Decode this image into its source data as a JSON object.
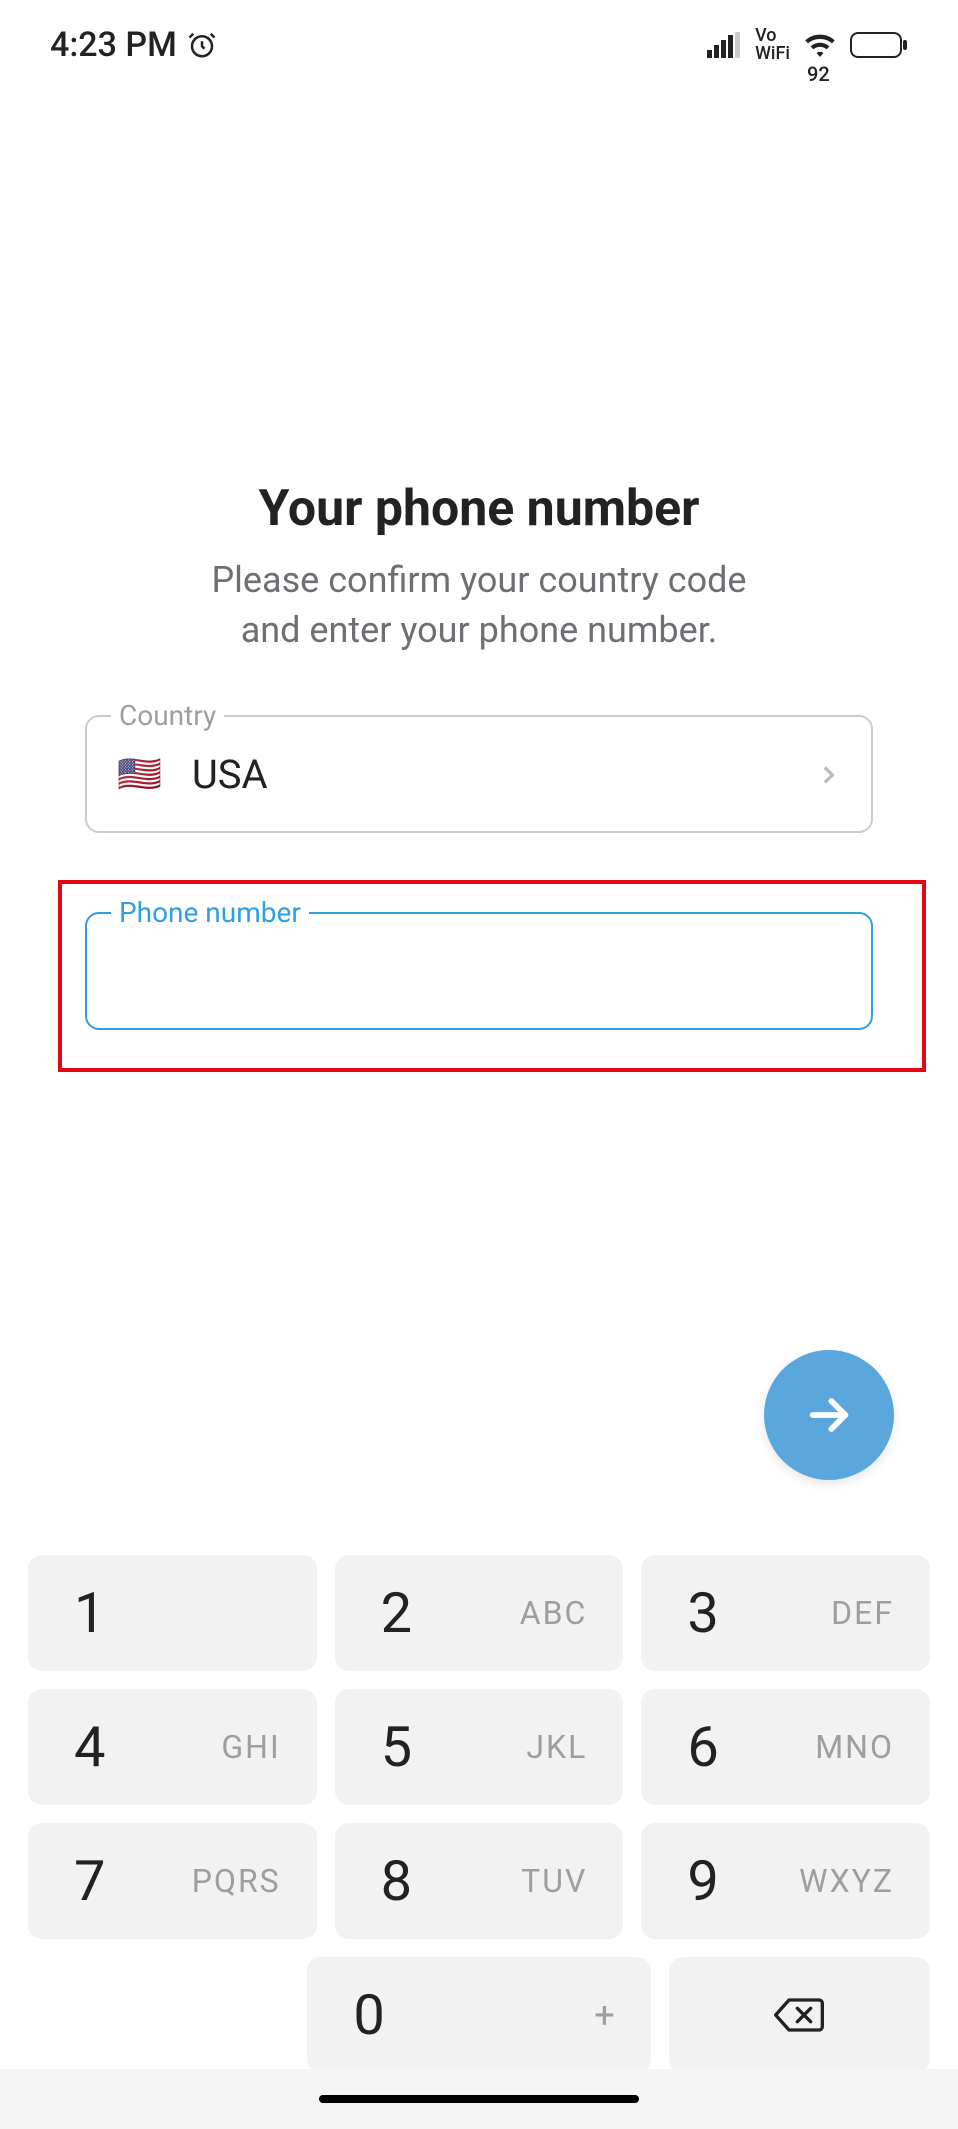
{
  "status_bar": {
    "time": "4:23 PM",
    "alarm_icon": "alarm",
    "signal_icon": "cellular-signal",
    "vo_wifi_top": "Vo",
    "vo_wifi_bottom": "WiFi",
    "wifi_icon": "wifi",
    "battery_level": "92"
  },
  "page_title": "Your phone number",
  "page_subtitle": "Please confirm your country code\nand enter your phone number.",
  "country_field": {
    "label": "Country",
    "flag": "🇺🇸",
    "value": "USA",
    "chevron_icon": "chevron-right"
  },
  "phone_field": {
    "label": "Phone number",
    "value": ""
  },
  "fab_icon": "arrow-right",
  "keypad": {
    "rows": [
      [
        {
          "num": "1",
          "letters": ""
        },
        {
          "num": "2",
          "letters": "ABC"
        },
        {
          "num": "3",
          "letters": "DEF"
        }
      ],
      [
        {
          "num": "4",
          "letters": "GHI"
        },
        {
          "num": "5",
          "letters": "JKL"
        },
        {
          "num": "6",
          "letters": "MNO"
        }
      ],
      [
        {
          "num": "7",
          "letters": "PQRS"
        },
        {
          "num": "8",
          "letters": "TUV"
        },
        {
          "num": "9",
          "letters": "WXYZ"
        }
      ]
    ],
    "zero": {
      "num": "0",
      "letters": "+"
    },
    "backspace_icon": "backspace"
  }
}
